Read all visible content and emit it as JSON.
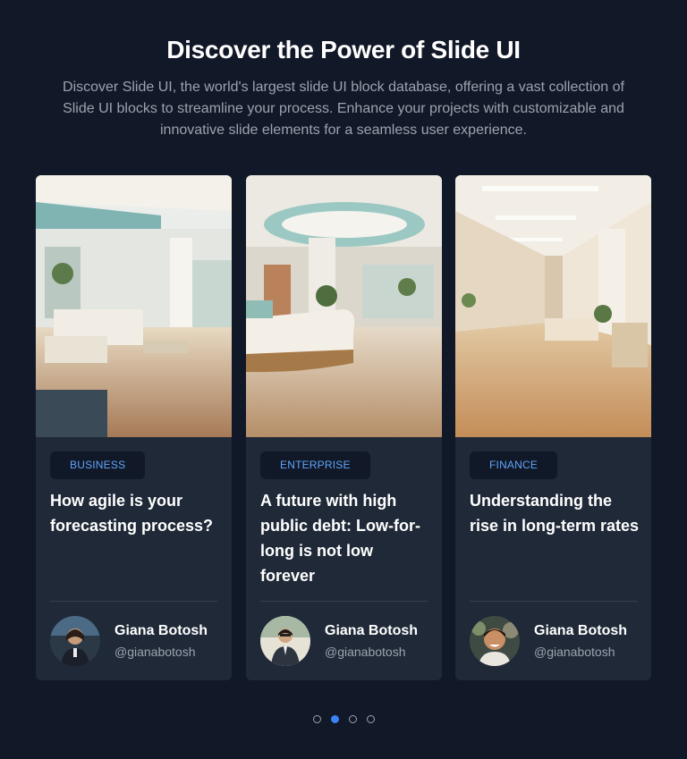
{
  "header": {
    "title": "Discover the Power of Slide UI",
    "subtitle": "Discover Slide UI, the world's largest slide UI block database, offering a vast collection of Slide UI blocks to streamline your process. Enhance your projects with customizable and innovative slide elements for a seamless user experience."
  },
  "cards": [
    {
      "category": "BUSINESS",
      "headline": "How agile is your forecasting process?",
      "author_name": "Giana Botosh",
      "author_handle": "@gianabotosh"
    },
    {
      "category": "ENTERPRISE",
      "headline": "A future with high public debt: Low-for-long is not low forever",
      "author_name": "Giana Botosh",
      "author_handle": "@gianabotosh"
    },
    {
      "category": "FINANCE",
      "headline": "Understanding the rise in long-term rates",
      "author_name": "Giana Botosh",
      "author_handle": "@gianabotosh"
    }
  ],
  "pagination": {
    "total": 4,
    "active_index": 1
  },
  "colors": {
    "background": "#111827",
    "card": "#1f2937",
    "accent": "#3b82f6",
    "badge_text": "#60a5fa",
    "muted_text": "#9ca3af"
  }
}
